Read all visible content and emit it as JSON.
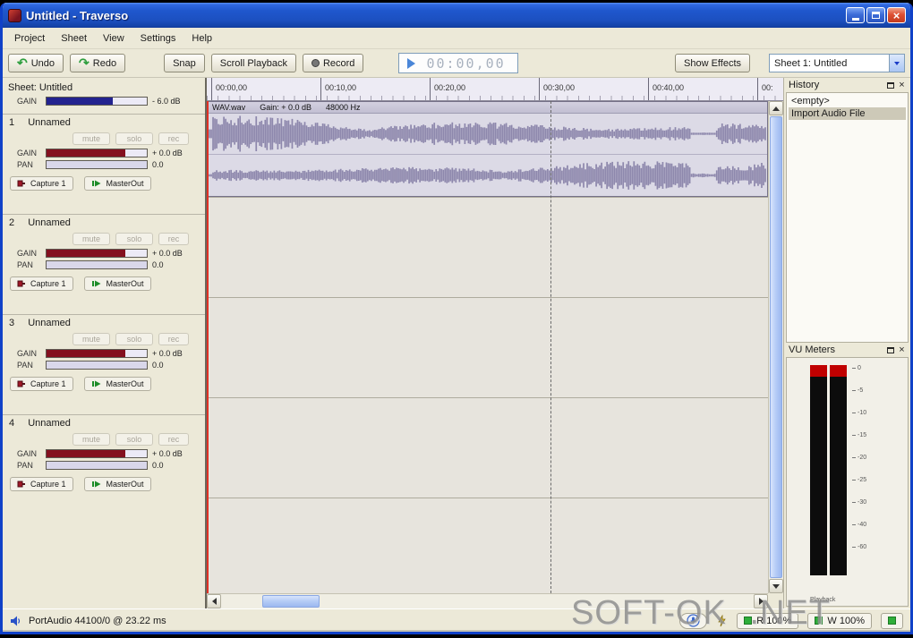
{
  "window": {
    "title": "Untitled - Traverso"
  },
  "menu": {
    "items": [
      "Project",
      "Sheet",
      "View",
      "Settings",
      "Help"
    ]
  },
  "toolbar": {
    "undo": "Undo",
    "redo": "Redo",
    "snap": "Snap",
    "scroll_playback": "Scroll Playback",
    "record": "Record",
    "time_display": "00:00,00",
    "show_effects": "Show Effects",
    "sheet_selector": "Sheet 1: Untitled"
  },
  "sheet_header": {
    "title": "Sheet: Untitled",
    "gain_label": "GAIN",
    "gain_value": "- 6.0 dB"
  },
  "tracks": [
    {
      "number": "1",
      "name": "Unnamed",
      "mute": "mute",
      "solo": "solo",
      "rec": "rec",
      "gain_label": "GAIN",
      "gain_value": "+ 0.0 dB",
      "pan_label": "PAN",
      "pan_value": "0.0",
      "input": "Capture 1",
      "output": "MasterOut"
    },
    {
      "number": "2",
      "name": "Unnamed",
      "mute": "mute",
      "solo": "solo",
      "rec": "rec",
      "gain_label": "GAIN",
      "gain_value": "+ 0.0 dB",
      "pan_label": "PAN",
      "pan_value": "0.0",
      "input": "Capture 1",
      "output": "MasterOut"
    },
    {
      "number": "3",
      "name": "Unnamed",
      "mute": "mute",
      "solo": "solo",
      "rec": "rec",
      "gain_label": "GAIN",
      "gain_value": "+ 0.0 dB",
      "pan_label": "PAN",
      "pan_value": "0.0",
      "input": "Capture 1",
      "output": "MasterOut"
    },
    {
      "number": "4",
      "name": "Unnamed",
      "mute": "mute",
      "solo": "solo",
      "rec": "rec",
      "gain_label": "GAIN",
      "gain_value": "+ 0.0 dB",
      "pan_label": "PAN",
      "pan_value": "0.0",
      "input": "Capture 1",
      "output": "MasterOut"
    }
  ],
  "timeline": {
    "ticks": [
      "00:00,00",
      "00:10,00",
      "00:20,00",
      "00:30,00",
      "00:40,00",
      "00:"
    ]
  },
  "clip": {
    "name": "WAV.wav",
    "gain": "Gain: + 0.0 dB",
    "samplerate": "48000 Hz"
  },
  "history_panel": {
    "title": "History",
    "items": [
      "<empty>",
      "Import Audio File"
    ],
    "selected_index": 1
  },
  "vu_panel": {
    "title": "VU Meters",
    "scale": [
      "0",
      "-5",
      "-10",
      "-15",
      "-20",
      "-25",
      "-30",
      "-40",
      "-60"
    ],
    "label": "Playback"
  },
  "statusbar": {
    "driver": "PortAudio   44100/0 @ 23.22 ms",
    "read": "R 100%",
    "write": "W 100%"
  },
  "watermark": "SOFT-OK .NET",
  "colors": {
    "accent_blue": "#1f57cd",
    "gain_red": "#84101f",
    "gain_blue": "#23238f",
    "waveform": "#8d87ac",
    "meter_red": "#c00000",
    "playhead_red": "#e03024"
  }
}
